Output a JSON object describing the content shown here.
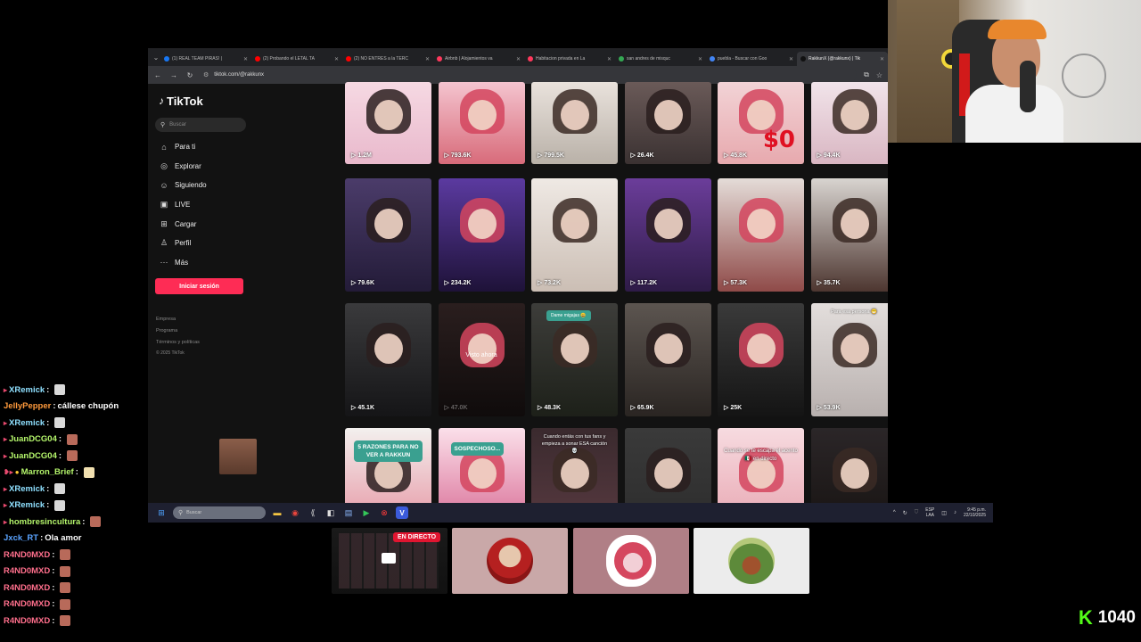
{
  "browser": {
    "tabs": [
      {
        "label": "(1) REAL TEAM PIRAS! |",
        "color": "#1877f2"
      },
      {
        "label": "(2) Probando el LETAL TA",
        "color": "#ff0000"
      },
      {
        "label": "(2) NO ENTRES a la TERC",
        "color": "#ff0000"
      },
      {
        "label": "Airbnb | Alojamientos va",
        "color": "#ff385c"
      },
      {
        "label": "Habitacion privada en La",
        "color": "#ff385c"
      },
      {
        "label": "san andres de misquc",
        "color": "#34a853"
      },
      {
        "label": "puebla - Buscar con Goo",
        "color": "#4285f4"
      },
      {
        "label": "RakkunX (@rakkunx) | Tik",
        "color": "#111111"
      }
    ],
    "url": "tiktok.com/@rakkunx"
  },
  "tiktok": {
    "logo": "TikTok",
    "search_placeholder": "Buscar",
    "nav": [
      {
        "label": "Para ti",
        "icon": "home-icon",
        "glyph": "⌂"
      },
      {
        "label": "Explorar",
        "icon": "compass-icon",
        "glyph": "◎"
      },
      {
        "label": "Siguiendo",
        "icon": "following-icon",
        "glyph": "☺"
      },
      {
        "label": "LIVE",
        "icon": "live-icon",
        "glyph": "▣"
      },
      {
        "label": "Cargar",
        "icon": "upload-icon",
        "glyph": "⊞"
      },
      {
        "label": "Perfil",
        "icon": "profile-icon",
        "glyph": "♙"
      },
      {
        "label": "Más",
        "icon": "more-icon",
        "glyph": "···"
      }
    ],
    "login_label": "Iniciar sesión",
    "footer": [
      "Empresa",
      "Programa",
      "Términos y políticas"
    ],
    "copyright": "© 2025 TikTok",
    "videos": [
      {
        "views": "1.2M",
        "bg": "linear-gradient(180deg,#f6d9e3,#e9b9cc)"
      },
      {
        "views": "793.6K",
        "bg": "linear-gradient(180deg,#f4c4cf,#d86b7a)"
      },
      {
        "views": "799.5K",
        "bg": "linear-gradient(180deg,#e9e2dc,#b9b1a8)"
      },
      {
        "views": "26.4K",
        "bg": "linear-gradient(180deg,#6a5a58,#3b3232)"
      },
      {
        "views": "45.8K",
        "bg": "linear-gradient(180deg,#f2d3d6,#e7a9ae)",
        "big": "$0"
      },
      {
        "views": "94.4K",
        "bg": "linear-gradient(180deg,#f1e4ea,#d9b6c2)"
      },
      {
        "views": "79.6K",
        "bg": "linear-gradient(180deg,#4b3c6a,#231b38)"
      },
      {
        "views": "234.2K",
        "bg": "linear-gradient(180deg,#5b3aa0,#1e1238)"
      },
      {
        "views": "73.2K",
        "bg": "linear-gradient(180deg,#efe9e4,#cbbeb4)"
      },
      {
        "views": "117.2K",
        "bg": "linear-gradient(180deg,#6b3d9a,#2e1b47)"
      },
      {
        "views": "57.3K",
        "bg": "linear-gradient(180deg,#e4dcd8,#8f4a48)"
      },
      {
        "views": "35.7K",
        "bg": "linear-gradient(180deg,#d8d4d0,#4d3630)"
      },
      {
        "views": "45.1K",
        "bg": "linear-gradient(180deg,#3a3a3c,#151517)"
      },
      {
        "views": "47.0K",
        "bg": "linear-gradient(180deg,#2a1e1e,#0f0b0b)",
        "overlay": "Visto ahora"
      },
      {
        "views": "48.3K",
        "bg": "linear-gradient(180deg,#3d3d3a,#1d2019)",
        "badge": "Dame migajas 😀"
      },
      {
        "views": "65.9K",
        "bg": "linear-gradient(180deg,#5c5550,#2a2522)"
      },
      {
        "views": "25K",
        "bg": "linear-gradient(180deg,#3a3a3a,#141414)"
      },
      {
        "views": "53.9K",
        "bg": "linear-gradient(180deg,#e3dedc,#b8b0ae)",
        "topnote": "Para esa persona 😁"
      },
      {
        "views": "",
        "bg": "linear-gradient(180deg,#f3f0ee,#e58b9b)",
        "caption": "5 RAZONES PARA NO VER A RAKKUN"
      },
      {
        "views": "",
        "bg": "linear-gradient(180deg,#fbe0ea,#d45d8a)",
        "caption2": "SOSPECHOSO..."
      },
      {
        "views": "",
        "bg": "linear-gradient(180deg,#3a2a2e,#5b3b42)",
        "topnote": "Cuando entás con tus fans y empieza a sonar ESA canción 💀"
      },
      {
        "views": "",
        "bg": "linear-gradient(180deg,#3a3a3a,#2b2b2b)"
      },
      {
        "views": "",
        "bg": "linear-gradient(180deg,#f7dbe0,#e6a0ac)",
        "topnote2": "Cuando se te escapa el acento 🇲🇽 en directo"
      },
      {
        "views": "",
        "bg": "linear-gradient(180deg,#2b2628,#15110f)"
      }
    ]
  },
  "taskbar": {
    "search_placeholder": "Buscar",
    "lang": [
      "ESP",
      "LAA"
    ],
    "time": "9:45 p.m.",
    "date": "22/10/2025"
  },
  "chat": [
    {
      "user": "XRemick",
      "color": "#8fe0ff",
      "text": "",
      "emote": "#d9d9d9"
    },
    {
      "user": "JellyPepper",
      "color": "#ff9a3c",
      "text": "cállese chupón",
      "emote": ""
    },
    {
      "user": "XRemick",
      "color": "#8fe0ff",
      "text": "",
      "emote": "#d9d9d9"
    },
    {
      "user": "JuanDCG04",
      "color": "#b4f56b",
      "text": "",
      "emote": "#b86a5a"
    },
    {
      "user": "JuanDCG04",
      "color": "#b4f56b",
      "text": "",
      "emote": "#b86a5a"
    },
    {
      "user": "Marron_Brief",
      "color": "#b4f56b",
      "text": "",
      "emote": "#f1e0b0"
    },
    {
      "user": "XRemick",
      "color": "#8fe0ff",
      "text": "",
      "emote": "#d9d9d9"
    },
    {
      "user": "XRemick",
      "color": "#8fe0ff",
      "text": "",
      "emote": "#d9d9d9"
    },
    {
      "user": "hombresincultura",
      "color": "#b4f56b",
      "text": "",
      "emote": "#b86a5a"
    },
    {
      "user": "Jxck_RT",
      "color": "#5aa3ff",
      "text": "Ola amor",
      "emote": ""
    },
    {
      "user": "R4ND0MXD",
      "color": "#ff6f8c",
      "text": "",
      "emote": "#b86a5a"
    },
    {
      "user": "R4ND0MXD",
      "color": "#ff6f8c",
      "text": "",
      "emote": "#b86a5a"
    },
    {
      "user": "R4ND0MXD",
      "color": "#ff6f8c",
      "text": "",
      "emote": "#b86a5a"
    },
    {
      "user": "R4ND0MXD",
      "color": "#ff6f8c",
      "text": "",
      "emote": "#b86a5a"
    },
    {
      "user": "R4ND0MXD",
      "color": "#ff6f8c",
      "text": "",
      "emote": "#b86a5a"
    }
  ],
  "stream": {
    "live_label": "EN DIRECTO",
    "viewer_count": "1040",
    "accent": "#53fc18"
  }
}
